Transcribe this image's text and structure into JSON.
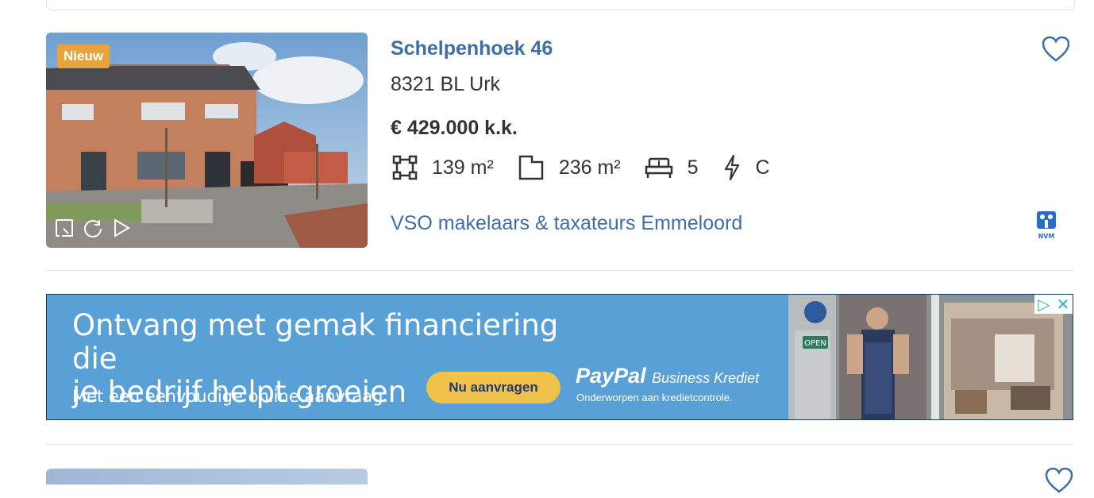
{
  "listing": {
    "badge": "Nieuw",
    "title": "Schelpenhoek 46",
    "address": "8321 BL Urk",
    "price": "€ 429.000 k.k.",
    "living_area": "139 m²",
    "plot_area": "236 m²",
    "rooms": "5",
    "energy_label": "C",
    "agent": "VSO makelaars & taxateurs Emmeloord",
    "agent_badge": "NVM",
    "accent_color": "#3e6ea6",
    "badge_color": "#e8a33d"
  },
  "ad": {
    "headline_line1": "Ontvang met gemak financiering die",
    "headline_line2": "je bedrijf helpt groeien",
    "subtext": "Met een eenvoudige online aanvraag.",
    "button_label": "Nu aanvragen",
    "brand": "PayPal",
    "product": "Business Krediet",
    "note": "Onderworpen aan kredietcontrole.",
    "sign_text": "OPEN",
    "background_color": "#58a0d5"
  }
}
